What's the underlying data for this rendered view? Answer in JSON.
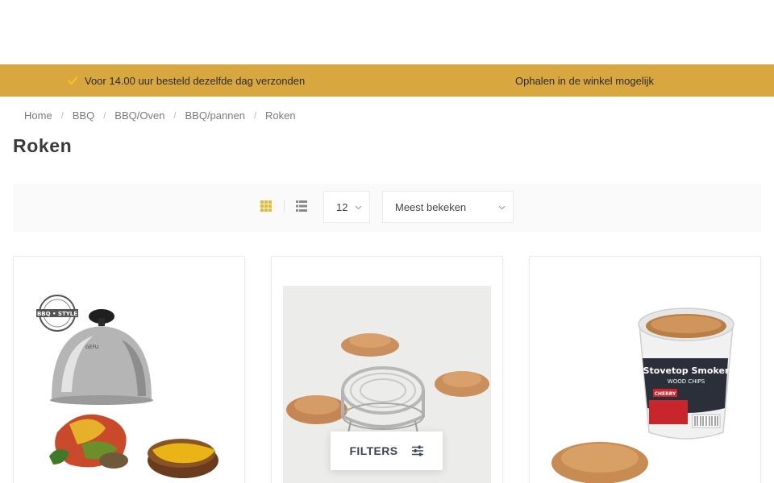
{
  "usp_bar": {
    "left_text": "Voor 14.00 uur besteld dezelfde dag verzonden",
    "right_text": "Ophalen in de winkel mogelijk",
    "background_color": "#d9a740",
    "check_color": "#f5c518"
  },
  "breadcrumb": [
    "Home",
    "BBQ",
    "BBQ/Oven",
    "BBQ/pannen",
    "Roken"
  ],
  "page_title": "Roken",
  "toolbar": {
    "grid_view_icon": "grid-icon",
    "list_view_icon": "list-icon",
    "active_view": "grid",
    "per_page": "12",
    "sort": "Meest bekeken"
  },
  "products": [
    {
      "image_icon": "bbq-dome-cover-image",
      "badge_text": "BBQ • STYLE",
      "brand_text": "GEFU"
    },
    {
      "image_icon": "smoker-box-wood-chips-image"
    },
    {
      "image_icon": "stovetop-smoker-wood-chips-image",
      "tub_title": "Stovetop Smoker",
      "tub_subtitle": "WOOD CHIPS",
      "tub_flavor": "CHERRY"
    }
  ],
  "filters_button": {
    "label": "FILTERS",
    "icon": "sliders-icon"
  }
}
